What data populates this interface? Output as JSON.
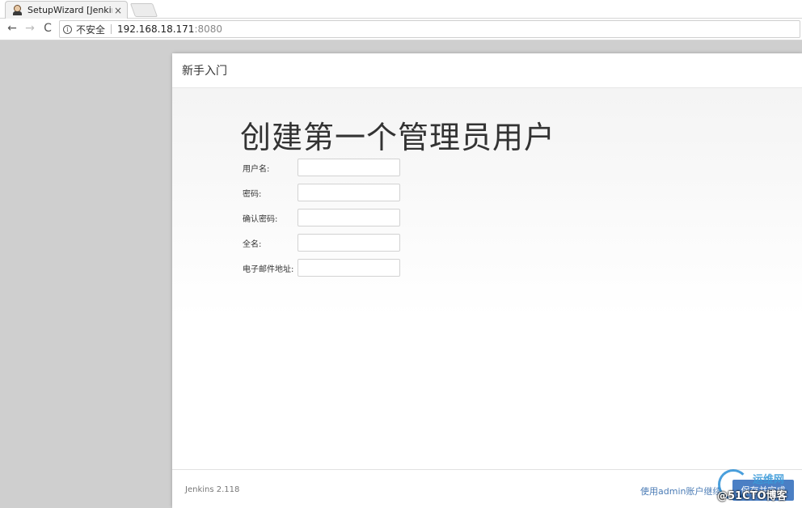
{
  "browser": {
    "tab_title": "SetupWizard [Jenkins]",
    "tab_close": "×",
    "insecure_label": "不安全",
    "url_host": "192.168.18.171",
    "url_port": ":8080",
    "icons": [
      "back-icon",
      "forward-icon",
      "reload-icon",
      "info-icon",
      "tab-favicon-icon"
    ]
  },
  "dialog": {
    "header_title": "新手入门",
    "page_title": "创建第一个管理员用户",
    "fields": [
      {
        "label": "用户名:",
        "value": ""
      },
      {
        "label": "密码:",
        "value": ""
      },
      {
        "label": "确认密码:",
        "value": ""
      },
      {
        "label": "全名:",
        "value": ""
      },
      {
        "label": "电子邮件地址:",
        "value": ""
      }
    ],
    "footer": {
      "version": "Jenkins 2.118",
      "continue_link": "使用admin账户继续",
      "save_button": "保存并完成"
    }
  },
  "watermark": {
    "top": "运维网",
    "bottom": "@51CTO博客"
  },
  "colors": {
    "primary_button": "#4b7fc4",
    "link": "#4a7bb5",
    "page_background": "#cfcfcf"
  }
}
